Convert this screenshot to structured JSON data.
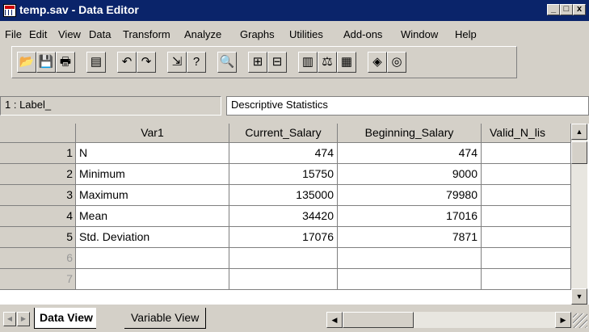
{
  "window": {
    "title": "temp.sav - Data Editor",
    "controls": [
      "_",
      "□",
      "x"
    ]
  },
  "menu": [
    {
      "label": "File"
    },
    {
      "label": "Edit"
    },
    {
      "label": "View"
    },
    {
      "label": "Data"
    },
    {
      "label": "Transform"
    },
    {
      "label": "Analyze"
    },
    {
      "label": "Graphs"
    },
    {
      "label": "Utilities"
    },
    {
      "label": "Add-ons"
    },
    {
      "label": "Window"
    },
    {
      "label": "Help"
    }
  ],
  "toolbar": [
    {
      "icon": "open-file-icon",
      "glyph": "📂"
    },
    {
      "icon": "save-icon",
      "glyph": "💾"
    },
    {
      "icon": "print-icon",
      "glyph": "🖶"
    },
    {
      "icon": "dialog-recall-icon",
      "glyph": "▤"
    },
    {
      "icon": "undo-icon",
      "glyph": "↶"
    },
    {
      "icon": "redo-icon",
      "glyph": "↷"
    },
    {
      "icon": "goto-case-icon",
      "glyph": "⇲"
    },
    {
      "icon": "variables-icon",
      "glyph": "?"
    },
    {
      "icon": "find-icon",
      "glyph": "🔍"
    },
    {
      "icon": "insert-cases-icon",
      "glyph": "⊞"
    },
    {
      "icon": "insert-variable-icon",
      "glyph": "⊟"
    },
    {
      "icon": "split-file-icon",
      "glyph": "▥"
    },
    {
      "icon": "weight-cases-icon",
      "glyph": "⚖"
    },
    {
      "icon": "select-cases-icon",
      "glyph": "▦"
    },
    {
      "icon": "value-labels-icon",
      "glyph": "◈"
    },
    {
      "icon": "use-sets-icon",
      "glyph": "◎"
    }
  ],
  "cell_editor": {
    "ref": "1 : Label_",
    "value": "Descriptive Statistics"
  },
  "grid": {
    "columns": [
      "Var1",
      "Current_Salary",
      "Beginning_Salary",
      "Valid_N_lis"
    ],
    "rows": [
      {
        "num": "1",
        "var1": "N",
        "current": "474",
        "beginning": "474",
        "valid": ""
      },
      {
        "num": "2",
        "var1": "Minimum",
        "current": "15750",
        "beginning": "9000",
        "valid": ""
      },
      {
        "num": "3",
        "var1": "Maximum",
        "current": "135000",
        "beginning": "79980",
        "valid": ""
      },
      {
        "num": "4",
        "var1": "Mean",
        "current": "34420",
        "beginning": "17016",
        "valid": ""
      },
      {
        "num": "5",
        "var1": "Std. Deviation",
        "current": "17076",
        "beginning": "7871",
        "valid": ""
      },
      {
        "num": "6",
        "var1": "",
        "current": "",
        "beginning": "",
        "valid": ""
      },
      {
        "num": "7",
        "var1": "",
        "current": "",
        "beginning": "",
        "valid": ""
      }
    ]
  },
  "tabs": {
    "data_view": "Data View",
    "variable_view": "Variable View"
  }
}
